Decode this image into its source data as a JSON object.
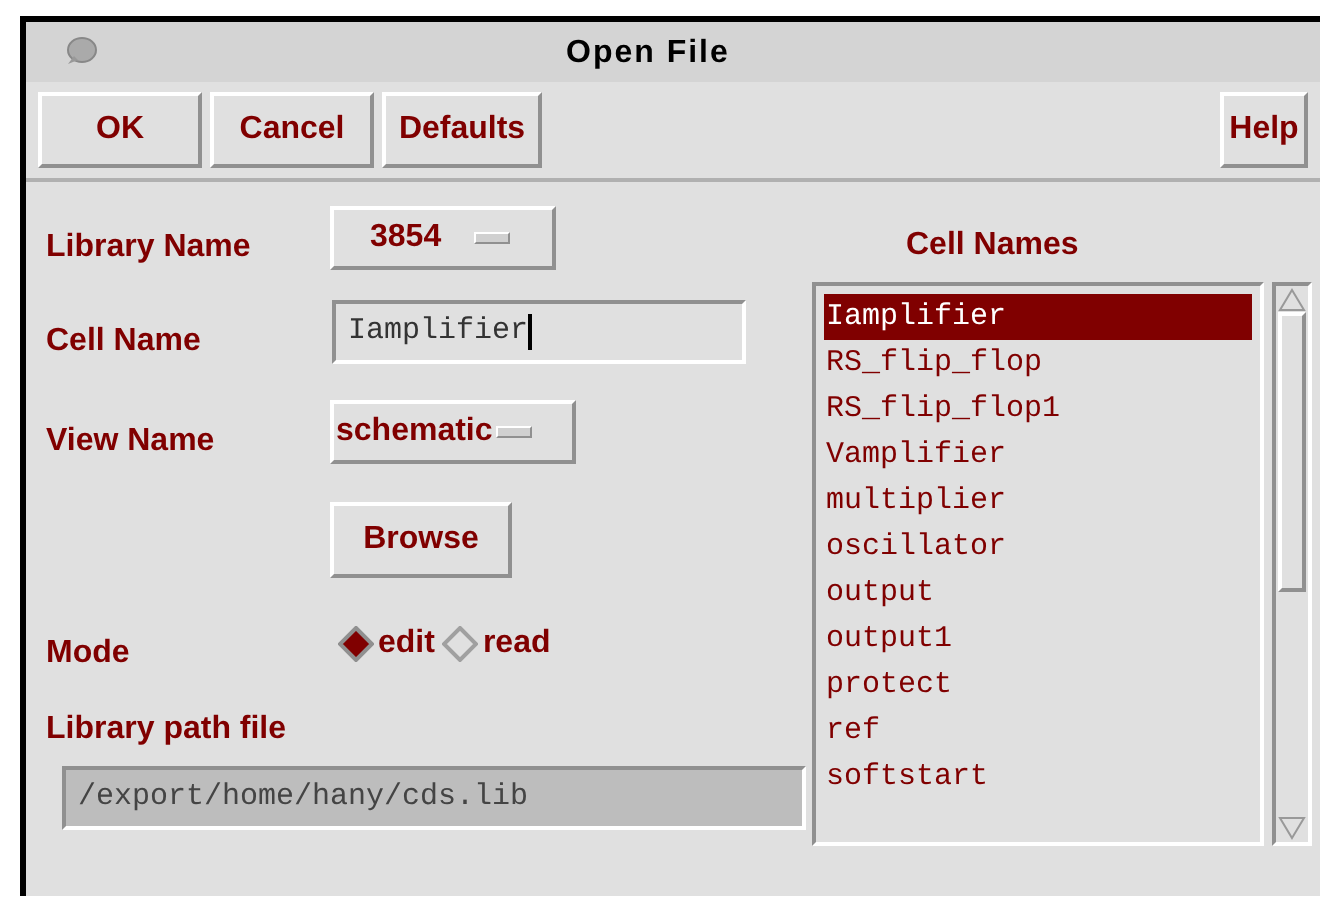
{
  "window": {
    "title": "Open File"
  },
  "toolbar_buttons": [
    "OK",
    "Cancel",
    "Defaults"
  ],
  "help_button": "Help",
  "library_name": {
    "label": "Library Name",
    "value": "3854"
  },
  "cell_name": {
    "label": "Cell Name",
    "value": "Iamplifier"
  },
  "view_name": {
    "label": "View Name",
    "value": "schematic"
  },
  "browse_button": "Browse",
  "mode": {
    "label": "Mode",
    "options": [
      {
        "label": "edit",
        "selected": true
      },
      {
        "label": "read",
        "selected": false
      }
    ]
  },
  "library_path": {
    "label": "Library path file",
    "value": "/export/home/hany/cds.lib"
  },
  "cell_names": {
    "title": "Cell Names",
    "items": [
      {
        "label": "Iamplifier",
        "selected": true
      },
      {
        "label": "RS_flip_flop",
        "selected": false
      },
      {
        "label": "RS_flip_flop1",
        "selected": false
      },
      {
        "label": "Vamplifier",
        "selected": false
      },
      {
        "label": "multiplier",
        "selected": false
      },
      {
        "label": "oscillator",
        "selected": false
      },
      {
        "label": "output",
        "selected": false
      },
      {
        "label": "output1",
        "selected": false
      },
      {
        "label": "protect",
        "selected": false
      },
      {
        "label": "ref",
        "selected": false
      },
      {
        "label": "softstart",
        "selected": false
      }
    ]
  }
}
